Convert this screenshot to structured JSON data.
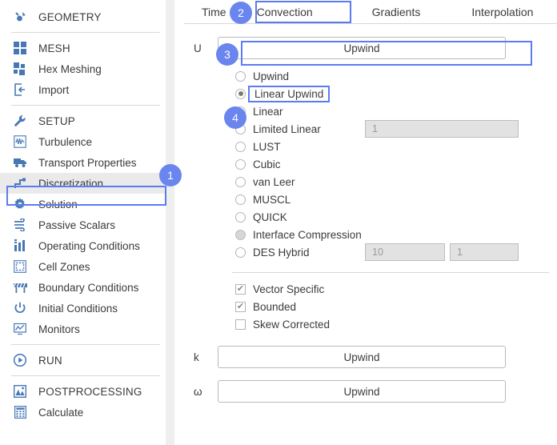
{
  "sidebar": {
    "groups": [
      {
        "items": [
          {
            "label": "GEOMETRY",
            "icon": "geometry-icon",
            "section": true,
            "selected": false
          }
        ]
      },
      {
        "items": [
          {
            "label": "MESH",
            "icon": "mesh-icon",
            "section": true,
            "selected": false
          },
          {
            "label": "Hex Meshing",
            "icon": "hex-meshing-icon",
            "section": false,
            "selected": false
          },
          {
            "label": "Import",
            "icon": "import-icon",
            "section": false,
            "selected": false
          }
        ]
      },
      {
        "items": [
          {
            "label": "SETUP",
            "icon": "wrench-icon",
            "section": true,
            "selected": false
          },
          {
            "label": "Turbulence",
            "icon": "turbulence-icon",
            "section": false,
            "selected": false
          },
          {
            "label": "Transport Properties",
            "icon": "truck-icon",
            "section": false,
            "selected": false
          },
          {
            "label": "Discretization",
            "icon": "discretization-icon",
            "section": false,
            "selected": true
          },
          {
            "label": "Solution",
            "icon": "gear-icon",
            "section": false,
            "selected": false
          },
          {
            "label": "Passive Scalars",
            "icon": "wind-icon",
            "section": false,
            "selected": false
          },
          {
            "label": "Operating Conditions",
            "icon": "bar-chart-icon",
            "section": false,
            "selected": false
          },
          {
            "label": "Cell Zones",
            "icon": "cell-zones-icon",
            "section": false,
            "selected": false
          },
          {
            "label": "Boundary Conditions",
            "icon": "barrier-icon",
            "section": false,
            "selected": false
          },
          {
            "label": "Initial Conditions",
            "icon": "power-icon",
            "section": false,
            "selected": false
          },
          {
            "label": "Monitors",
            "icon": "monitor-icon",
            "section": false,
            "selected": false
          }
        ]
      },
      {
        "items": [
          {
            "label": "RUN",
            "icon": "play-icon",
            "section": true,
            "selected": false
          }
        ]
      },
      {
        "items": [
          {
            "label": "POSTPROCESSING",
            "icon": "image-icon",
            "section": true,
            "selected": false
          },
          {
            "label": "Calculate",
            "icon": "calculator-icon",
            "section": false,
            "selected": false
          }
        ]
      }
    ]
  },
  "main": {
    "tabs": [
      {
        "label": "Time",
        "active": false
      },
      {
        "label": "Convection",
        "active": true
      },
      {
        "label": "Gradients",
        "active": false
      },
      {
        "label": "Interpolation",
        "active": false
      }
    ],
    "u_field": {
      "label": "U",
      "value": "Upwind"
    },
    "schemes": [
      {
        "label": "Upwind",
        "checked": false,
        "disabled": false,
        "highlighted": false
      },
      {
        "label": "Linear Upwind",
        "checked": true,
        "disabled": false,
        "highlighted": true
      },
      {
        "label": "Linear",
        "checked": false,
        "disabled": false,
        "highlighted": false
      },
      {
        "label": "Limited Linear",
        "checked": false,
        "disabled": false,
        "highlighted": false
      },
      {
        "label": "LUST",
        "checked": false,
        "disabled": false,
        "highlighted": false
      },
      {
        "label": "Cubic",
        "checked": false,
        "disabled": false,
        "highlighted": false
      },
      {
        "label": "van Leer",
        "checked": false,
        "disabled": false,
        "highlighted": false
      },
      {
        "label": "MUSCL",
        "checked": false,
        "disabled": false,
        "highlighted": false
      },
      {
        "label": "QUICK",
        "checked": false,
        "disabled": false,
        "highlighted": false
      },
      {
        "label": "Interface Compression",
        "checked": false,
        "disabled": true,
        "highlighted": false
      },
      {
        "label": "DES Hybrid",
        "checked": false,
        "disabled": false,
        "highlighted": false
      }
    ],
    "limited_linear_value": "1",
    "des_hybrid_value_1": "10",
    "des_hybrid_value_2": "1",
    "options": [
      {
        "label": "Vector Specific",
        "checked": true
      },
      {
        "label": "Bounded",
        "checked": true
      },
      {
        "label": "Skew Corrected",
        "checked": false
      }
    ],
    "k_field": {
      "label": "k",
      "value": "Upwind"
    },
    "omega_field": {
      "label": "ω",
      "value": "Upwind"
    }
  },
  "callouts": [
    {
      "number": "1"
    },
    {
      "number": "2"
    },
    {
      "number": "3"
    },
    {
      "number": "4"
    }
  ],
  "colors": {
    "accent": "#5b7cf0",
    "badge": "#6a85ee",
    "icon_blue": "#4878b4",
    "selected_row": "#eaeaea"
  }
}
